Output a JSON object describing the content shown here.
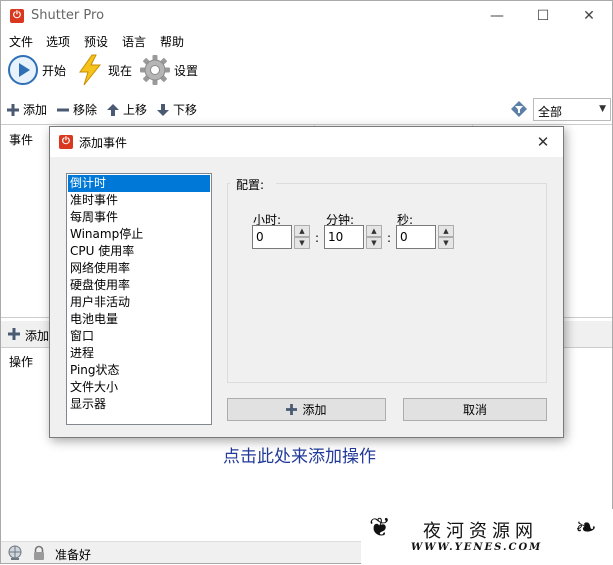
{
  "window": {
    "title": "Shutter Pro",
    "minimize": "—",
    "maximize": "☐",
    "close": "✕"
  },
  "menu": [
    "文件",
    "选项",
    "预设",
    "语言",
    "帮助"
  ],
  "toolbar": {
    "start": "开始",
    "now": "现在",
    "settings": "设置"
  },
  "event_toolbar": {
    "add": "添加",
    "remove": "移除",
    "move_up": "上移",
    "move_down": "下移",
    "filter_value": "全部"
  },
  "events_panel": {
    "header": "事件"
  },
  "actions_bar": {
    "add": "添加"
  },
  "actions_panel": {
    "header": "操作",
    "add_link": "点击此处来添加操作"
  },
  "status": {
    "text": "准备好"
  },
  "watermark": {
    "main": "夜河资源网",
    "sub": "WWW.YENES.COM"
  },
  "dialog": {
    "title": "添加事件",
    "close": "✕",
    "events": [
      "倒计时",
      "准时事件",
      "每周事件",
      "Winamp停止",
      "CPU 使用率",
      "网络使用率",
      "硬盘使用率",
      "用户非活动",
      "电池电量",
      "窗口",
      "进程",
      "Ping状态",
      "文件大小",
      "显示器"
    ],
    "selected_index": 0,
    "config_label": "配置:",
    "hours_label": "小时:",
    "minutes_label": "分钟:",
    "seconds_label": "秒:",
    "hours_value": "0",
    "minutes_value": "10",
    "seconds_value": "0",
    "separator": ":",
    "add_button": "添加",
    "cancel_button": "取消"
  },
  "colors": {
    "accent": "#0078d7",
    "link": "#223a99",
    "app_icon": "#d9381e"
  }
}
